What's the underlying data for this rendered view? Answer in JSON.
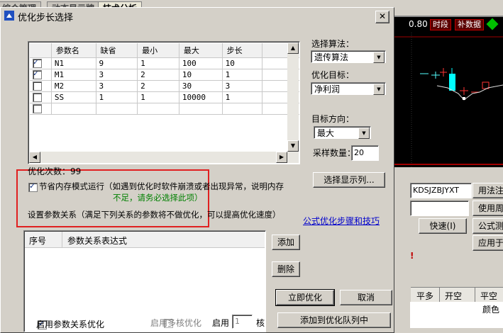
{
  "background": {
    "tabs": [
      "综合管理",
      "动态显示牌",
      "技术分析"
    ],
    "chart_value": "0.80",
    "chip_period": "时段",
    "chip_supplement": "补数据",
    "formula_code": "KDSJZBJYXT",
    "speed_button": "快速(I)",
    "side_buttons": [
      "用法注",
      "使用周",
      "公式测",
      "应用于"
    ],
    "columns": [
      "平多",
      "开空",
      "平空"
    ],
    "color_label": "颜色"
  },
  "dialog": {
    "title": "优化步长选择",
    "close": "✕",
    "grid": {
      "headers": [
        "参数名",
        "缺省",
        "最小",
        "最大",
        "步长"
      ],
      "rows": [
        {
          "checked": true,
          "name": "N1",
          "default": "9",
          "min": "1",
          "max": "100",
          "step": "10"
        },
        {
          "checked": true,
          "name": "M1",
          "default": "3",
          "min": "2",
          "max": "10",
          "step": "1"
        },
        {
          "checked": false,
          "name": "M2",
          "default": "3",
          "min": "2",
          "max": "30",
          "step": "3"
        },
        {
          "checked": false,
          "name": "SS",
          "default": "1",
          "min": "1",
          "max": "10000",
          "step": "1"
        },
        {
          "checked": false,
          "name": "",
          "default": "",
          "min": "",
          "max": "",
          "step": ""
        }
      ]
    },
    "algorithm_label": "选择算法：",
    "algorithm_value": "遗传算法",
    "target_label": "优化目标：",
    "target_value": "净利润",
    "direction_label": "目标方向：",
    "direction_value": "最大",
    "sample_label": "采样数量：",
    "sample_value": "20",
    "opt_count": "优化次数：99",
    "select_columns_button": "选择显示列...",
    "memory_checkbox_label": "节省内存模式运行（如遇到优化时软件崩溃或者出现异常，说明内存",
    "memory_checkbox_checked": true,
    "memory_note": "不足，请务必选择此项）",
    "relation_label": "设置参数关系（满足下列关系的参数将不做优化，可以提高优化速度）",
    "tips_link": "公式优化步骤和技巧",
    "relation_headers": [
      "序号",
      "参数关系表达式"
    ],
    "add_button": "添加",
    "delete_button": "删除",
    "optimize_button": "立即优化",
    "cancel_button": "取消",
    "enable_relation_label": "启用参数关系优化",
    "enable_relation_checked": true,
    "multicore_label": "启用多核优化",
    "enable_label": "启用",
    "cores_value": "1",
    "cores_unit": "核",
    "queue_button": "添加到优化队列中"
  }
}
